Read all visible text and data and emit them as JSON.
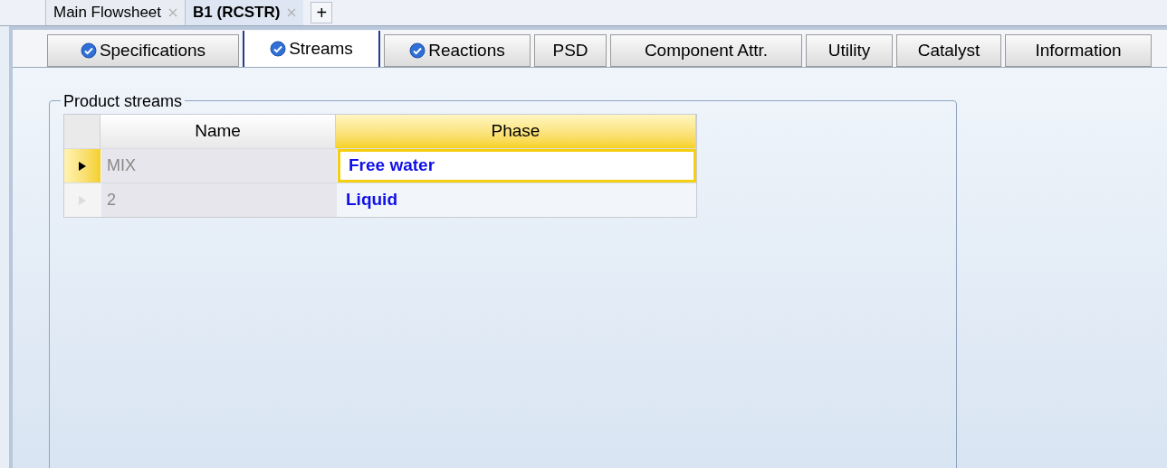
{
  "document_tabs": [
    {
      "label": "Main Flowsheet",
      "selected": false
    },
    {
      "label": "B1 (RCSTR)",
      "selected": true
    }
  ],
  "new_tab_button": "+",
  "form_tabs": [
    {
      "label": "Specifications",
      "complete": true,
      "selected": false
    },
    {
      "label": "Streams",
      "complete": true,
      "selected": true
    },
    {
      "label": "Reactions",
      "complete": true,
      "selected": false
    },
    {
      "label": "PSD",
      "complete": false,
      "selected": false
    },
    {
      "label": "Component Attr.",
      "complete": false,
      "selected": false
    },
    {
      "label": "Utility",
      "complete": false,
      "selected": false
    },
    {
      "label": "Catalyst",
      "complete": false,
      "selected": false
    },
    {
      "label": "Information",
      "complete": false,
      "selected": false
    }
  ],
  "product_streams": {
    "title": "Product streams",
    "columns": [
      {
        "label": "Name",
        "selected": false
      },
      {
        "label": "Phase",
        "selected": true
      }
    ],
    "rows": [
      {
        "name": "MIX",
        "phase": "Free water",
        "selected": true
      },
      {
        "name": "2",
        "phase": "Liquid",
        "selected": false
      }
    ]
  }
}
